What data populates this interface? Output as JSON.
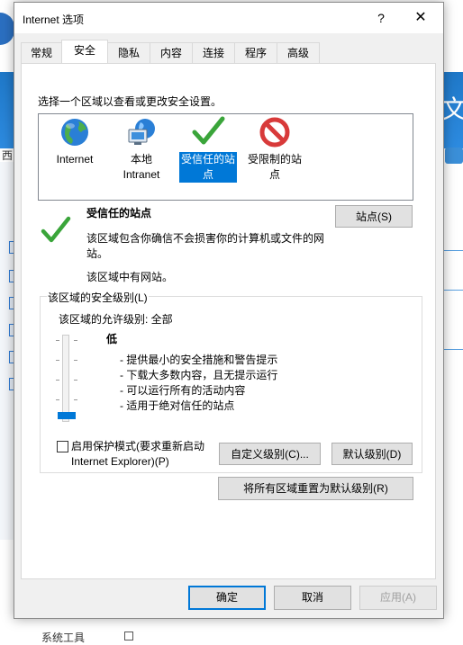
{
  "background": {
    "right_text": "文",
    "left_text": "西",
    "bottom_text": "系统工具"
  },
  "dialog": {
    "title": "Internet 选项",
    "help": "?",
    "close": "✕"
  },
  "tabs": [
    {
      "label": "常规"
    },
    {
      "label": "安全",
      "active": true
    },
    {
      "label": "隐私"
    },
    {
      "label": "内容"
    },
    {
      "label": "连接"
    },
    {
      "label": "程序"
    },
    {
      "label": "高级"
    }
  ],
  "security": {
    "instruction": "选择一个区域以查看或更改安全设置。",
    "zones": [
      {
        "label": "Internet",
        "icon": "globe-icon"
      },
      {
        "label": "本地 Intranet",
        "icon": "intranet-icon"
      },
      {
        "label": "受信任的站点",
        "icon": "checkmark-icon",
        "selected": true
      },
      {
        "label": "受限制的站点",
        "icon": "prohibited-icon"
      }
    ],
    "zone_name": "受信任的站点",
    "zone_description": "该区域包含你确信不会损害你的计算机或文件的网站。",
    "zone_has_sites": "该区域中有网站。",
    "sites_button": "站点(S)",
    "level_group_label": "该区域的安全级别(L)",
    "allowed_levels": "该区域的允许级别: 全部",
    "level_name": "低",
    "level_bullets": [
      "- 提供最小的安全措施和警告提示",
      "- 下载大多数内容，且无提示运行",
      "- 可以运行所有的活动内容",
      "- 适用于绝对信任的站点"
    ],
    "slider_level": 0,
    "protected_mode_label": "启用保护模式(要求重新启动 Internet Explorer)(P)",
    "protected_mode_checked": false,
    "custom_level_button": "自定义级别(C)...",
    "default_level_button": "默认级别(D)",
    "reset_all_button": "将所有区域重置为默认级别(R)"
  },
  "footer": {
    "ok": "确定",
    "cancel": "取消",
    "apply": "应用(A)"
  },
  "colors": {
    "accent": "#0078d7",
    "check_green": "#3aa53a",
    "prohibited_red": "#d83a3a"
  }
}
